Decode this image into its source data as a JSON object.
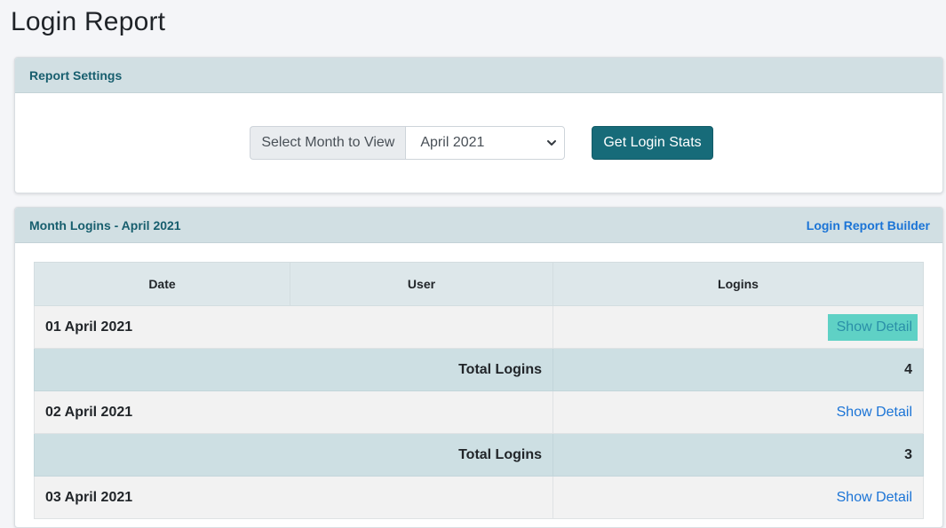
{
  "page_title": "Login Report",
  "settings": {
    "header": "Report Settings",
    "month_label": "Select Month to View",
    "month_value": "April 2021",
    "submit_label": "Get Login Stats"
  },
  "logins": {
    "header": "Month Logins - April 2021",
    "builder_link": "Login Report Builder",
    "columns": [
      "Date",
      "User",
      "Logins"
    ],
    "days": [
      {
        "date": "01 April 2021",
        "detail_label": "Show Detail",
        "total_label": "Total Logins",
        "total": "4"
      },
      {
        "date": "02 April 2021",
        "detail_label": "Show Detail",
        "total_label": "Total Logins",
        "total": "3"
      },
      {
        "date": "03 April 2021",
        "detail_label": "Show Detail"
      }
    ]
  },
  "colors": {
    "accent": "#176b79",
    "header_bg": "#d1dfe3",
    "link": "#1b74d6",
    "highlight": "#5fd1c5"
  }
}
